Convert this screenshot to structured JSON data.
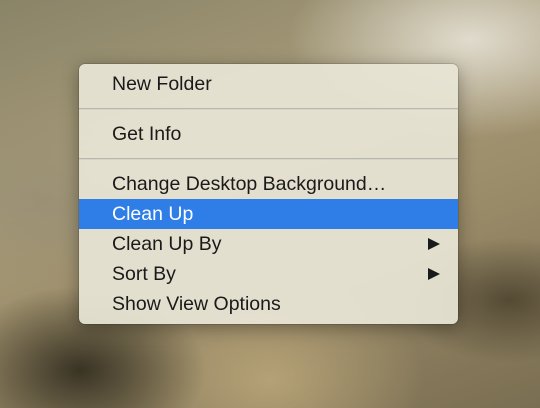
{
  "context_menu": {
    "new_folder": "New Folder",
    "get_info": "Get Info",
    "change_background": "Change Desktop Background…",
    "clean_up": "Clean Up",
    "clean_up_by": "Clean Up By",
    "sort_by": "Sort By",
    "show_view_options": "Show View Options",
    "highlight_color": "#2f7ee8",
    "submenu_icon": "triangle-right-icon"
  }
}
